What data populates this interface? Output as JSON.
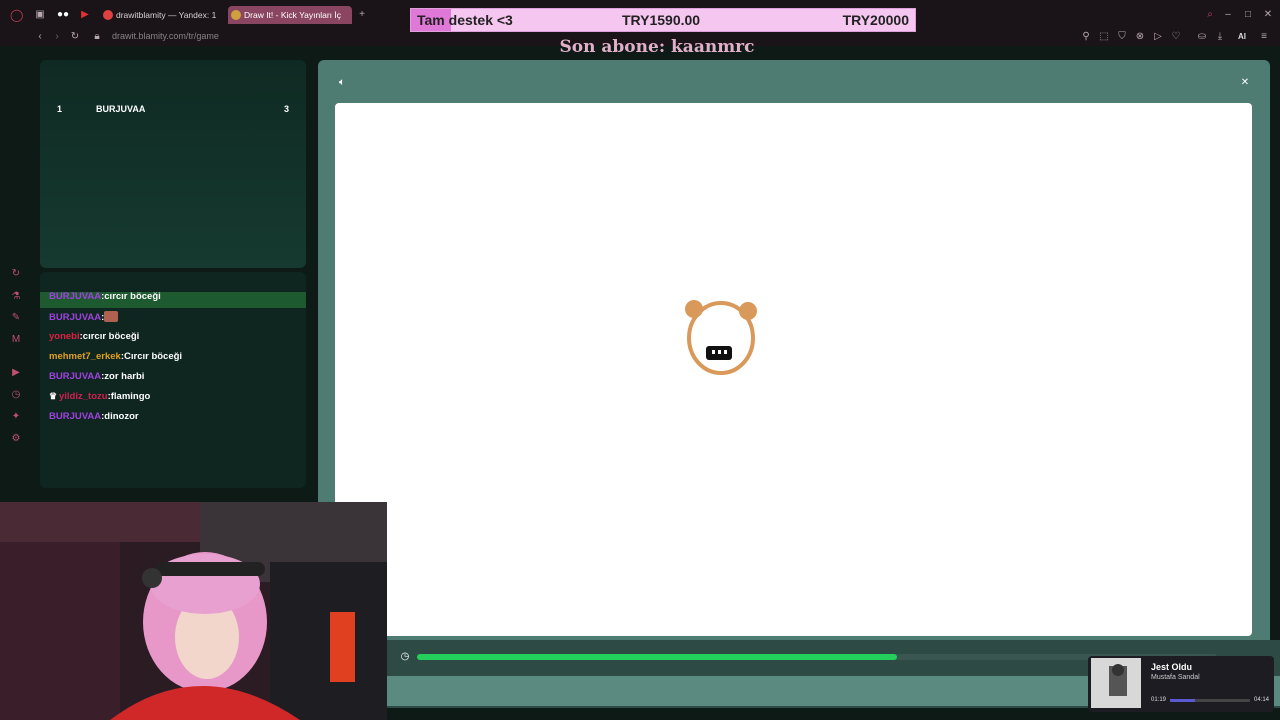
{
  "browser": {
    "tabs": [
      {
        "label": "drawitblamity — Yandex: 1",
        "favicon_color": "#e04040"
      },
      {
        "label": "Draw It! - Kick Yayınları İç",
        "favicon_color": "#d0a040"
      }
    ],
    "url": "drawit.blamity.com/tr/game",
    "ai_label": "AI"
  },
  "donation": {
    "text": "Tam destek <3",
    "current": "TRY1590.00",
    "goal": "TRY20000",
    "progress": 0.08
  },
  "subscriber": {
    "text": "Son abone: kaanmrc"
  },
  "leaderboard": {
    "rows": [
      {
        "rank": "1",
        "name": "BURJUVAA",
        "score": "3"
      }
    ]
  },
  "chat": {
    "messages": [
      {
        "user": "BURJUVAA",
        "sep": ":",
        "text": "cırcır böceği",
        "user_color": "#a040e0",
        "highlight": true
      },
      {
        "user": "BURJUVAA",
        "sep": ":",
        "text": "",
        "user_color": "#a040e0",
        "emote": true
      },
      {
        "user": "yonebi",
        "sep": ":",
        "text": "cırcır böceği",
        "user_color": "#e02040"
      },
      {
        "user": "mehmet7_erkek",
        "sep": ":",
        "text": "Cırcır böceği",
        "user_color": "#e0a020"
      },
      {
        "user": "BURJUVAA",
        "sep": ":",
        "text": "zor harbi",
        "user_color": "#a040e0"
      },
      {
        "user": "yildiz_tozu",
        "sep": ":",
        "text": "flamingo",
        "user_color": "#d02050",
        "badge": true
      },
      {
        "user": "BURJUVAA",
        "sep": ":",
        "text": "dinozor",
        "user_color": "#a040e0"
      }
    ]
  },
  "game": {
    "timer_progress": 0.6,
    "accent": "#22d05a"
  },
  "music": {
    "title": "Jest Oldu",
    "artist": "Mustafa Sandal",
    "current": "01:19",
    "duration": "04:14",
    "progress": 0.31
  }
}
